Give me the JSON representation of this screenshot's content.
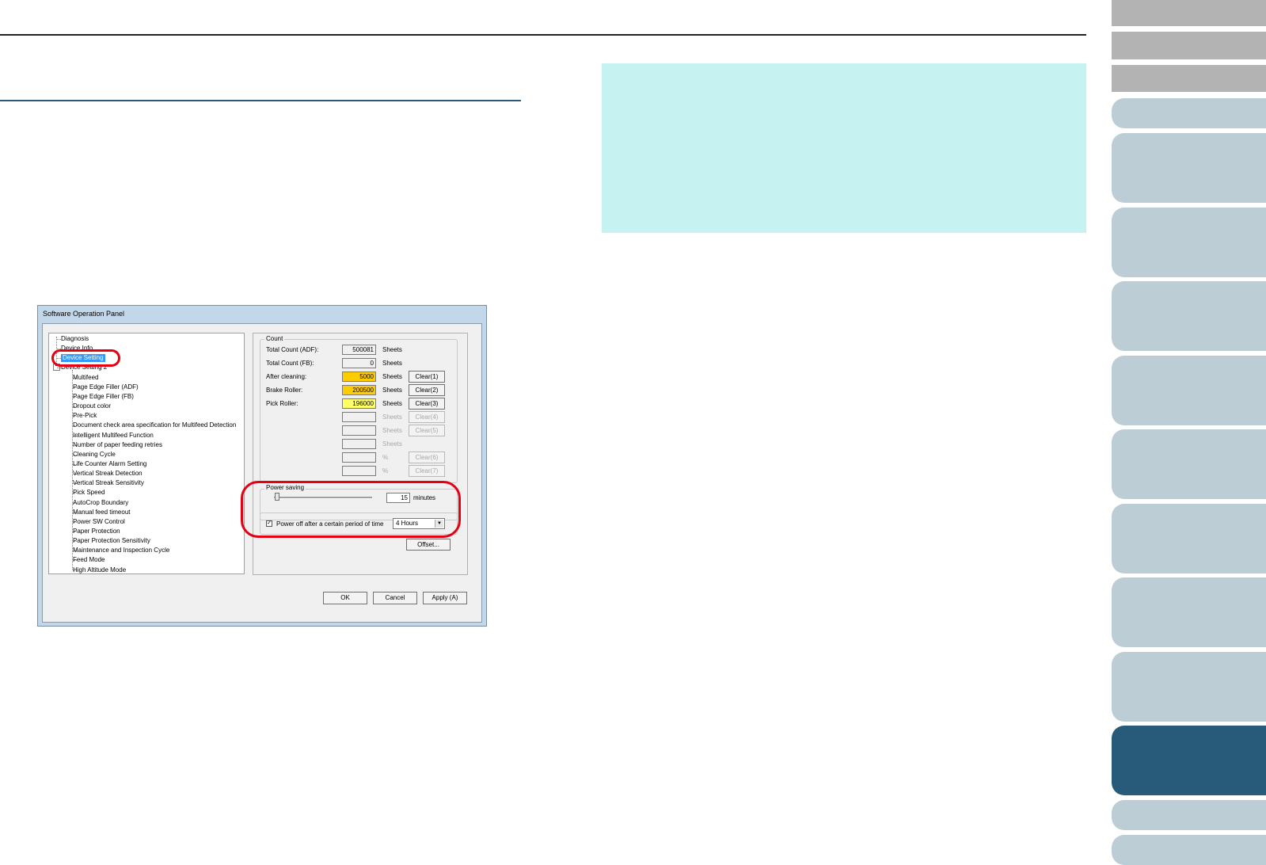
{
  "dialog": {
    "title": "Software Operation Panel",
    "tree": [
      {
        "label": "Diagnosis"
      },
      {
        "label": "Device Info"
      },
      {
        "label": "Device Setting"
      },
      {
        "label": "Device Setting 2"
      },
      {
        "label": "Multifeed"
      },
      {
        "label": "Page Edge Filler (ADF)"
      },
      {
        "label": "Page Edge Filler (FB)"
      },
      {
        "label": "Dropout color"
      },
      {
        "label": "Pre-Pick"
      },
      {
        "label": "Document check area specification for Multifeed Detection"
      },
      {
        "label": "Intelligent Multifeed Function"
      },
      {
        "label": "Number of paper feeding retries"
      },
      {
        "label": "Cleaning Cycle"
      },
      {
        "label": "Life Counter Alarm Setting"
      },
      {
        "label": "Vertical Streak Detection"
      },
      {
        "label": "Vertical Streak Sensitivity"
      },
      {
        "label": "Pick Speed"
      },
      {
        "label": "AutoCrop Boundary"
      },
      {
        "label": "Manual feed timeout"
      },
      {
        "label": "Power SW Control"
      },
      {
        "label": "Paper Protection"
      },
      {
        "label": "Paper Protection Sensitivity"
      },
      {
        "label": "Maintenance and Inspection Cycle"
      },
      {
        "label": "Feed Mode"
      },
      {
        "label": "High Altitude Mode"
      }
    ],
    "count": {
      "group_label": "Count",
      "rows": [
        {
          "label": "Total Count (ADF):",
          "value": "500081",
          "unit": "Sheets",
          "clear": ""
        },
        {
          "label": "Total Count (FB):",
          "value": "0",
          "unit": "Sheets",
          "clear": ""
        },
        {
          "label": "After cleaning:",
          "value": "5000",
          "unit": "Sheets",
          "clear": "Clear(1)"
        },
        {
          "label": "Brake Roller:",
          "value": "200500",
          "unit": "Sheets",
          "clear": "Clear(2)"
        },
        {
          "label": "Pick Roller:",
          "value": "196000",
          "unit": "Sheets",
          "clear": "Clear(3)"
        },
        {
          "label": "",
          "value": "",
          "unit": "Sheets",
          "clear": "Clear(4)"
        },
        {
          "label": "",
          "value": "",
          "unit": "Sheets",
          "clear": "Clear(5)"
        },
        {
          "label": "",
          "value": "",
          "unit": "Sheets",
          "clear": ""
        },
        {
          "label": "",
          "value": "",
          "unit": "%",
          "clear": "Clear(6)"
        },
        {
          "label": "",
          "value": "",
          "unit": "%",
          "clear": "Clear(7)"
        }
      ]
    },
    "power_saving": {
      "group_label": "Power saving",
      "value": "15",
      "unit": "minutes",
      "power_off_label": "Power off after a certain period of time",
      "power_off_checked": true,
      "power_off_selected": "4 Hours",
      "checkmark": "✓",
      "arrow": "▼"
    },
    "offset_button": "Offset...",
    "ok_button": "OK",
    "cancel_button": "Cancel",
    "apply_button": "Apply (A)"
  },
  "colors": {
    "info_box": "#c6f2f2",
    "nav_tab": "#bccdd6",
    "nav_tab_active": "#285b7a",
    "nav_tab_gray": "#b3b3b3",
    "highlight_ring": "#e60012",
    "count_orange": "#ffcc00",
    "count_yellow": "#ffff66"
  }
}
